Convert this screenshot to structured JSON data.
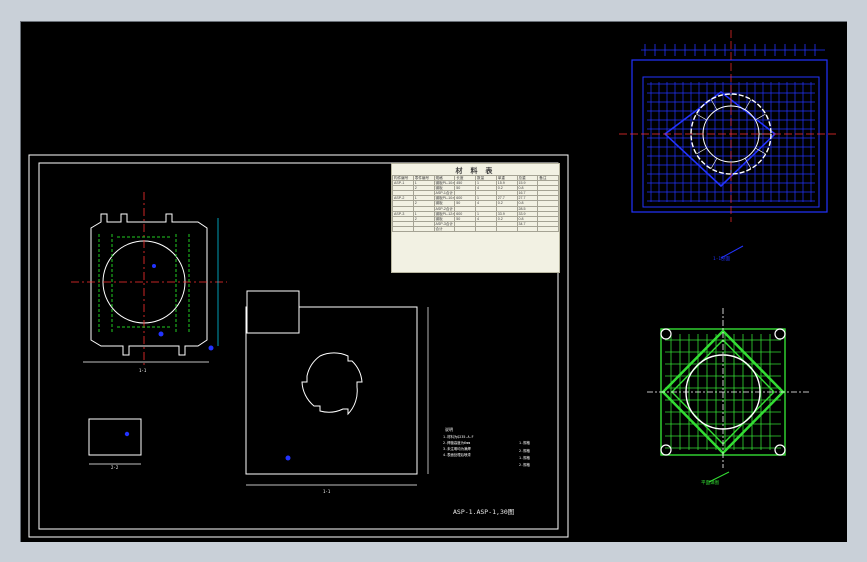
{
  "drawing": {
    "title_block_text": "ASP-1.ASP-1,30图",
    "notes_heading": "说明",
    "notes_lines": [
      "1.材料为Q235-A.F",
      "2.焊缝高度为6mm",
      "3.未注明均为满焊",
      "4.表面处理后喷漆"
    ],
    "note_tags": [
      "1.规格",
      "2.规格",
      "1.规格",
      "2.规格"
    ]
  },
  "material_table": {
    "title": "材 料 表",
    "header_left": [
      "构件编号",
      "零件编号",
      "规格",
      "长度",
      "数量"
    ],
    "header_right": [
      "重量(kg)",
      "单重",
      "总重",
      "备注"
    ],
    "groups": [
      {
        "id": "ASP-1",
        "rows": [
          [
            "ASP-1",
            "1",
            "钢板PL-10×450",
            "450",
            "1",
            "15.9",
            "15.9",
            ""
          ],
          [
            "",
            "2",
            "钢板",
            "50",
            "4",
            "0.2",
            "0.8",
            ""
          ],
          [
            "",
            "",
            "ASP-1合计",
            "",
            "",
            "",
            "16.7",
            ""
          ]
        ]
      },
      {
        "id": "ASP-2",
        "rows": [
          [
            "ASP-2",
            "1",
            "钢板PL-10×600",
            "600",
            "1",
            "27.7",
            "27.7",
            ""
          ],
          [
            "",
            "2",
            "钢板",
            "50",
            "4",
            "0.2",
            "0.8",
            ""
          ],
          [
            "",
            "",
            "ASP-2合计",
            "",
            "",
            "",
            "28.5",
            ""
          ]
        ]
      },
      {
        "id": "ASP-3",
        "rows": [
          [
            "ASP-3",
            "1",
            "钢板PL-12×600",
            "600",
            "1",
            "33.9",
            "33.9",
            ""
          ],
          [
            "",
            "2",
            "钢板",
            "50",
            "4",
            "0.2",
            "0.8",
            ""
          ],
          [
            "",
            "",
            "ASP-3合计",
            "",
            "",
            "",
            "34.7",
            ""
          ]
        ]
      }
    ],
    "total_label": "合计"
  },
  "views": {
    "blue_label": "1-1剖面",
    "green_label": "平面详图",
    "plan_label": "1-1",
    "plate_label": "1-1",
    "small_label": "2-2"
  },
  "colors": {
    "cad_background": "#000000",
    "window_chrome": "#c9d0d8",
    "plan_lines": "#ffffff",
    "dim_cyan": "#00e0ff",
    "hidden_green": "#22cc22",
    "axis_red": "#ff3030",
    "blue_detail": "#2233ff",
    "green_detail": "#33dd33",
    "table_bg": "#f2f1e3"
  }
}
